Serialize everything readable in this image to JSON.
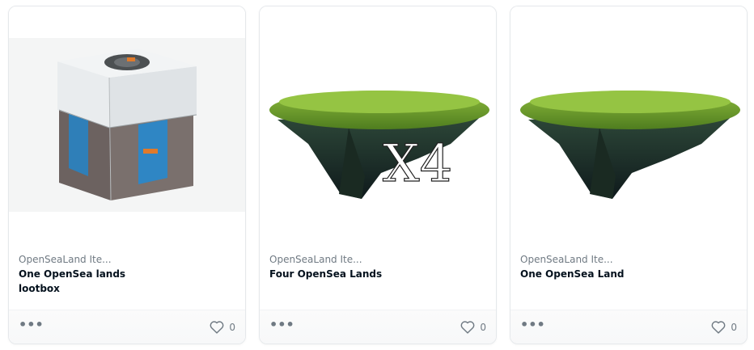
{
  "cards": [
    {
      "collection": "OpenSeaLand Ite...",
      "name": "One OpenSea lands lootbox",
      "favorites": "0",
      "image": "lootbox-image",
      "more": "•••"
    },
    {
      "collection": "OpenSeaLand Ite...",
      "name": "Four OpenSea Lands",
      "favorites": "0",
      "image": "floating-island-x4-image",
      "badge": "X4",
      "more": "•••"
    },
    {
      "collection": "OpenSeaLand Ite...",
      "name": "One OpenSea Land",
      "favorites": "0",
      "image": "floating-island-image",
      "more": "•••"
    }
  ],
  "icons": {
    "more": "more-options-icon",
    "favorite": "heart-icon"
  },
  "colors": {
    "text_primary": "#04111d",
    "text_secondary": "#707a83",
    "border": "#e5e8eb",
    "grass": "#6f9a2e",
    "rock": "#1f2e2a"
  }
}
